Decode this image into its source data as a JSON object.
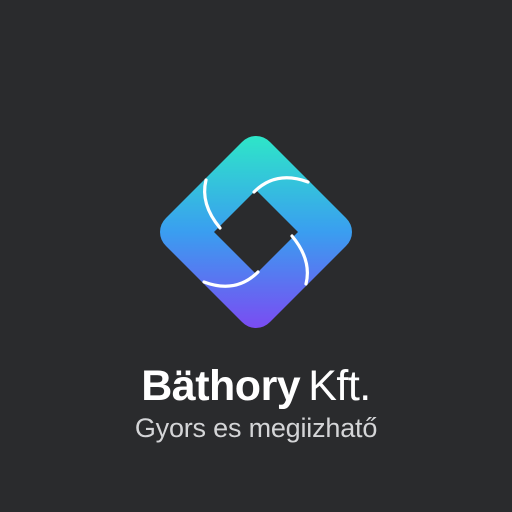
{
  "logo": {
    "icon": "rotated-square-aperture-icon",
    "gradient": [
      "#2ee6c8",
      "#3a9ef0",
      "#7a4cf2"
    ]
  },
  "brand": {
    "name": "Bäthory",
    "suffix": "Kft.",
    "tagline": "Gyors es megiizhatő"
  },
  "colors": {
    "background": "#2a2b2d",
    "name_text": "#ffffff",
    "tagline_text": "#d4d5d7"
  }
}
